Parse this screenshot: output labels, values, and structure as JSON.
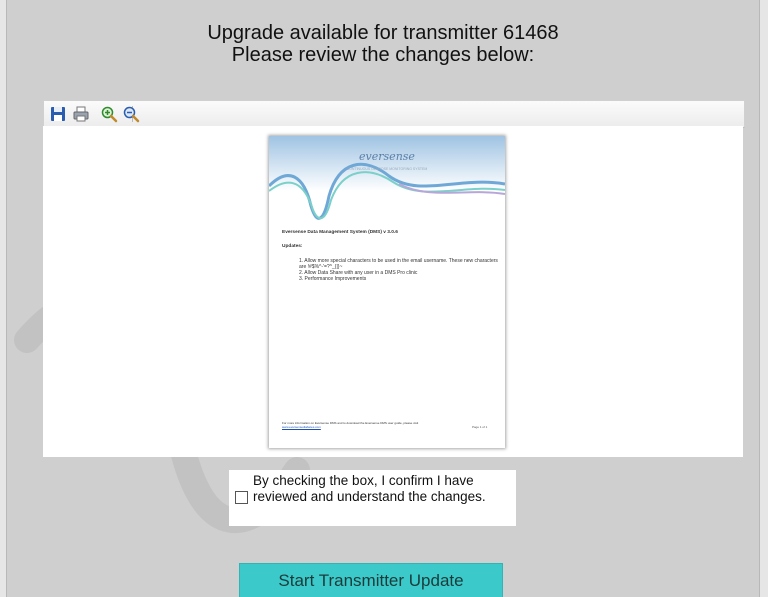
{
  "header": {
    "line1": "Upgrade available for transmitter 61468",
    "line2": "Please review the changes below:"
  },
  "toolbar": {
    "icons": [
      "save-icon",
      "print-icon",
      "zoom-in-icon",
      "zoom-out-icon"
    ]
  },
  "document": {
    "logo": "eversense",
    "tagline": "CONTINUOUS GLUCOSE MONITORING SYSTEM",
    "title": "Eversense Data Management System (DMS) v 3.0.6",
    "updates_heading": "Updates:",
    "items": [
      "1. Allow more special characters to be used in the email username. These new characters are !#$%^-'=?^_{|}~",
      "2. Allow Data Share with any user in a DMS Pro clinic",
      "3. Performance Improvements"
    ],
    "footer_text": "For more information on Eversense DMS and to download the Eversense DMS user guide, please visit",
    "footer_link": "www.eversensediabetes.com",
    "page_label": "Page 1 of 1"
  },
  "confirm": {
    "text": "By checking the box, I confirm I have reviewed and understand the changes.",
    "checked": false
  },
  "actions": {
    "start_label": "Start Transmitter Update"
  },
  "colors": {
    "background": "#cfcfcf",
    "accent_button": "#3cc9c9",
    "logo_blue": "#5a7fa8"
  }
}
